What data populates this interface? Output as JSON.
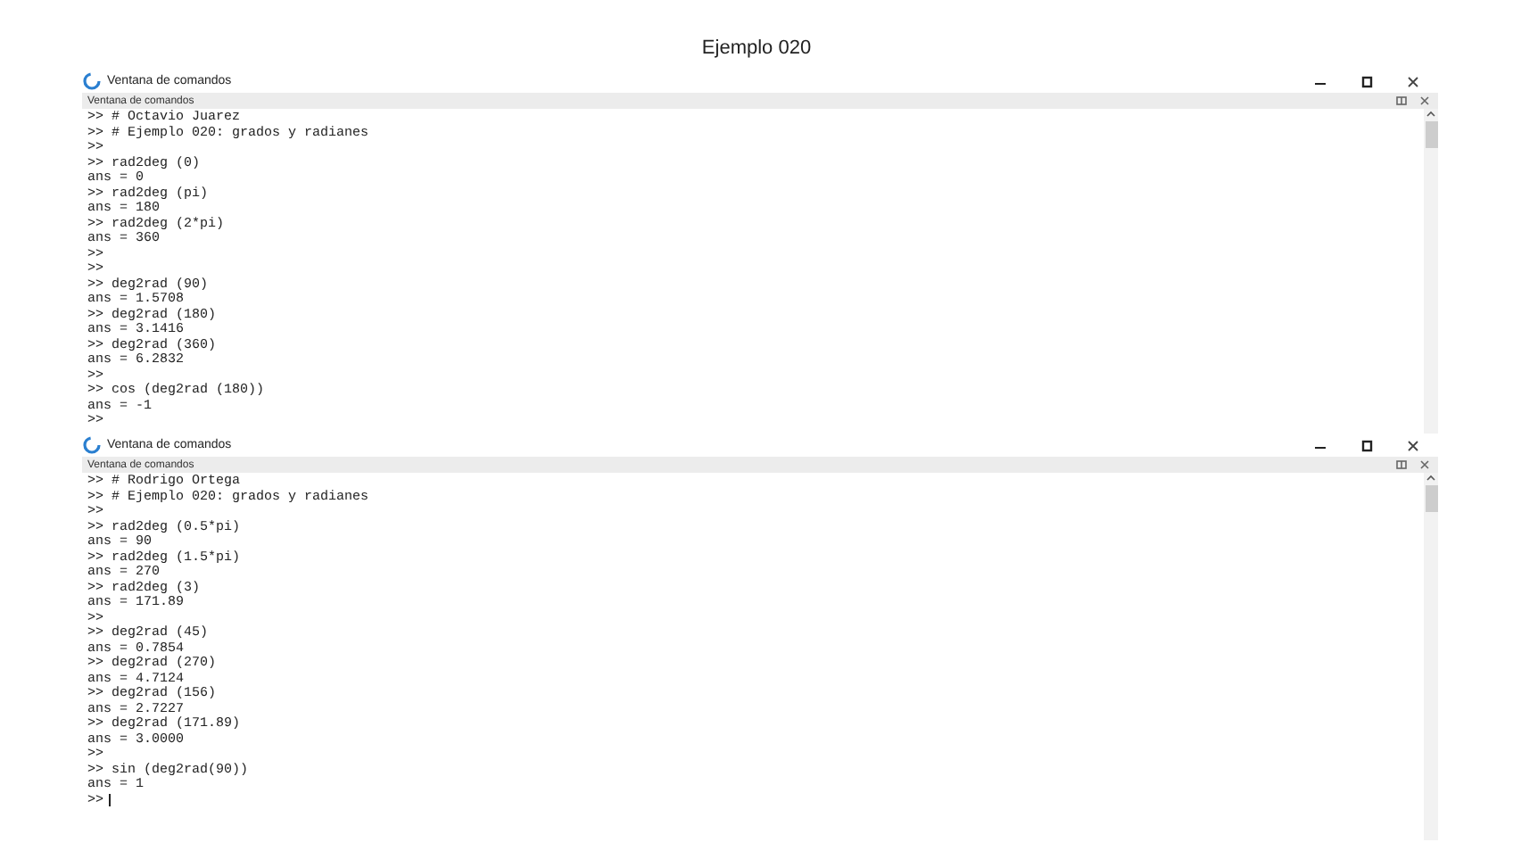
{
  "title": "Ejemplo 020",
  "panels": [
    {
      "title": "Ventana de comandos",
      "subtitle": "Ventana de comandos",
      "cursor": false,
      "lines": [
        ">> # Octavio Juarez",
        ">> # Ejemplo 020: grados y radianes",
        ">>",
        ">> rad2deg (0)",
        "ans = 0",
        ">> rad2deg (pi)",
        "ans = 180",
        ">> rad2deg (2*pi)",
        "ans = 360",
        ">>",
        ">>",
        ">> deg2rad (90)",
        "ans = 1.5708",
        ">> deg2rad (180)",
        "ans = 3.1416",
        ">> deg2rad (360)",
        "ans = 6.2832",
        ">>",
        ">> cos (deg2rad (180))",
        "ans = -1",
        ">>"
      ]
    },
    {
      "title": "Ventana de comandos",
      "subtitle": "Ventana de comandos",
      "cursor": true,
      "lines": [
        ">> # Rodrigo Ortega",
        ">> # Ejemplo 020: grados y radianes",
        ">>",
        ">> rad2deg (0.5*pi)",
        "ans = 90",
        ">> rad2deg (1.5*pi)",
        "ans = 270",
        ">> rad2deg (3)",
        "ans = 171.89",
        ">>",
        ">> deg2rad (45)",
        "ans = 0.7854",
        ">> deg2rad (270)",
        "ans = 4.7124",
        ">> deg2rad (156)",
        "ans = 2.7227",
        ">> deg2rad (171.89)",
        "ans = 3.0000",
        ">>",
        ">> sin (deg2rad(90))",
        "ans = 1",
        ">>"
      ]
    }
  ]
}
